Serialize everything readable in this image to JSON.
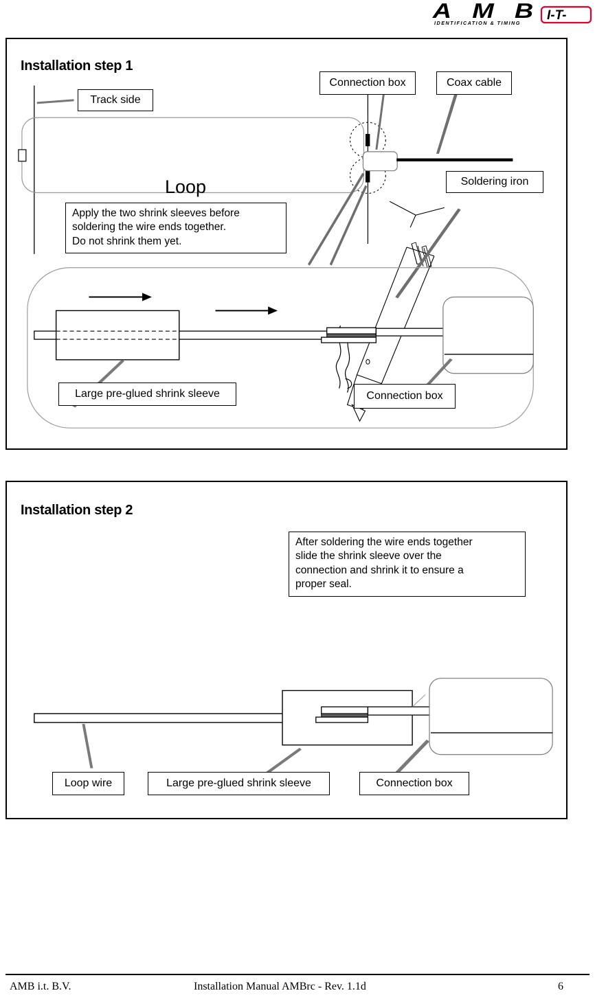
{
  "header": {
    "logo_main": "AMB",
    "logo_subtitle": "IDENTIFICATION & TIMING",
    "logo_badge": "I-T-",
    "badge_color": "#E3002B"
  },
  "step1": {
    "title": "Installation step 1",
    "loop_label": "Loop",
    "labels": {
      "track_side": "Track side",
      "connection_box_top": "Connection box",
      "coax_cable": "Coax cable",
      "soldering_iron": "Soldering iron",
      "shrink_sleeve": "Large pre-glued shrink sleeve",
      "connection_box_bottom": "Connection box"
    },
    "note": {
      "line1": "Apply the two shrink sleeves before",
      "line2": "soldering the wire ends together.",
      "line3": "Do not shrink them yet."
    }
  },
  "step2": {
    "title": "Installation step 2",
    "note": {
      "line1": "After soldering the wire ends together",
      "line2": "slide the shrink sleeve over the",
      "line3": "connection and shrink it to ensure a",
      "line4": "proper seal."
    },
    "labels": {
      "loop_wire": "Loop wire",
      "shrink_sleeve": "Large pre-glued shrink sleeve",
      "connection_box": "Connection box"
    }
  },
  "footer": {
    "company": "AMB i.t. B.V.",
    "manual": "Installation Manual AMBrc - Rev. 1.1d",
    "page": "6"
  }
}
